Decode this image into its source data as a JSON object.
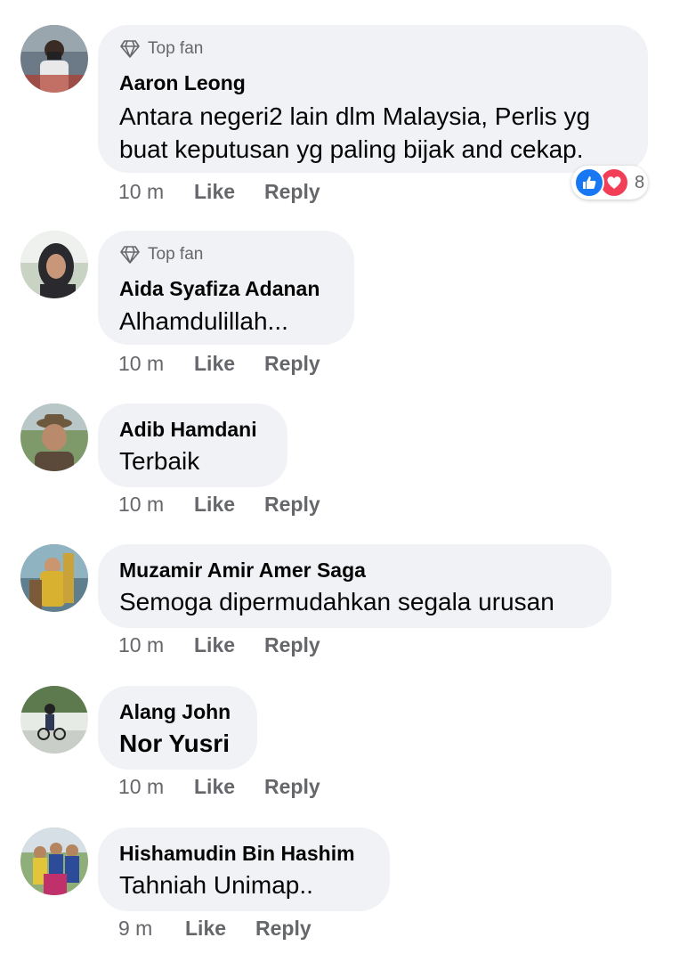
{
  "badge_label": "Top fan",
  "actions": {
    "like": "Like",
    "reply": "Reply"
  },
  "comments": [
    {
      "author": "Aaron Leong",
      "top_fan": true,
      "lines": [
        "Antara negeri2 lain dlm Malaysia, Perlis yg",
        "buat keputusan yg paling bijak and cekap."
      ],
      "time": "10 m",
      "reactions": {
        "types": [
          "like",
          "love"
        ],
        "count": "8"
      }
    },
    {
      "author": "Aida Syafiza Adanan",
      "top_fan": true,
      "lines": [
        "Alhamdulillah..."
      ],
      "time": "10 m"
    },
    {
      "author": "Adib Hamdani",
      "top_fan": false,
      "lines": [
        "Terbaik"
      ],
      "time": "10 m"
    },
    {
      "author": "Muzamir Amir Amer Saga",
      "top_fan": false,
      "lines": [
        "Semoga dipermudahkan segala urusan"
      ],
      "time": "10 m"
    },
    {
      "author": "Alang John",
      "top_fan": false,
      "lines": [
        "Nor Yusri"
      ],
      "mention": true,
      "time": "10 m"
    },
    {
      "author": "Hishamudin Bin Hashim",
      "top_fan": false,
      "lines": [
        "Tahniah Unimap.."
      ],
      "time": "9 m"
    }
  ],
  "colors": {
    "bubble": "#f0f2f5",
    "secondary_text": "#65676b",
    "like_blue": "#1877f2",
    "love_red": "#f33e58"
  }
}
